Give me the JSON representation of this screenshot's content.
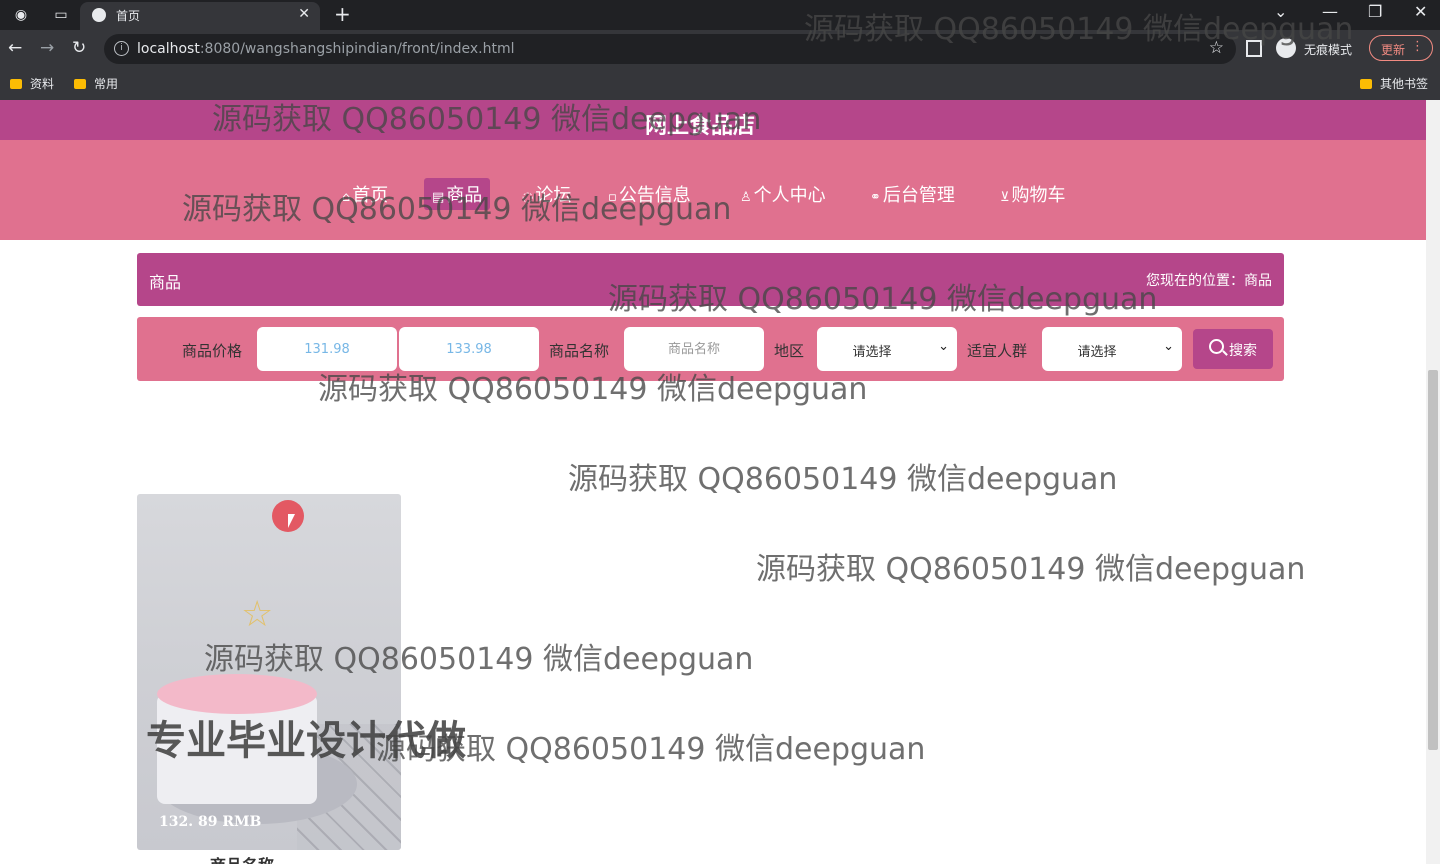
{
  "browser": {
    "tab_title": "首页",
    "url_host": "localhost",
    "url_rest": ":8080/wangshangshipindian/front/index.html",
    "incognito_label": "无痕模式",
    "update_label": "更新",
    "bookmarks": [
      "资料",
      "常用"
    ],
    "other_bookmarks": "其他书签"
  },
  "site": {
    "title": "网上食品店",
    "nav": [
      {
        "label": "首页",
        "icon": "home-icon"
      },
      {
        "label": "商品",
        "icon": "goods-icon"
      },
      {
        "label": "论坛",
        "icon": "forum-icon"
      },
      {
        "label": "公告信息",
        "icon": "notice-icon"
      },
      {
        "label": "个人中心",
        "icon": "user-icon"
      },
      {
        "label": "后台管理",
        "icon": "link-icon"
      },
      {
        "label": "购物车",
        "icon": "cart-icon"
      }
    ],
    "active_nav": "商品"
  },
  "breadcrumb": {
    "section": "商品",
    "location": "您现在的位置：商品"
  },
  "search": {
    "price_label": "商品价格",
    "price_min_placeholder": "131.98",
    "price_max_placeholder": "133.98",
    "name_label": "商品名称",
    "name_placeholder": "商品名称",
    "region_label": "地区",
    "region_value": "请选择",
    "crowd_label": "适宜人群",
    "crowd_value": "请选择",
    "button_label": "搜索"
  },
  "products": [
    {
      "price": "132. 89 RMB",
      "name": "商品名称"
    }
  ],
  "overlay": {
    "watermark": "源码获取 QQ86050149 微信deepguan",
    "banner": "专业毕业设计代做"
  },
  "colors": {
    "primary": "#b5468a",
    "secondary": "#e0718f",
    "accent_price_placeholder": "#77b7e6"
  }
}
